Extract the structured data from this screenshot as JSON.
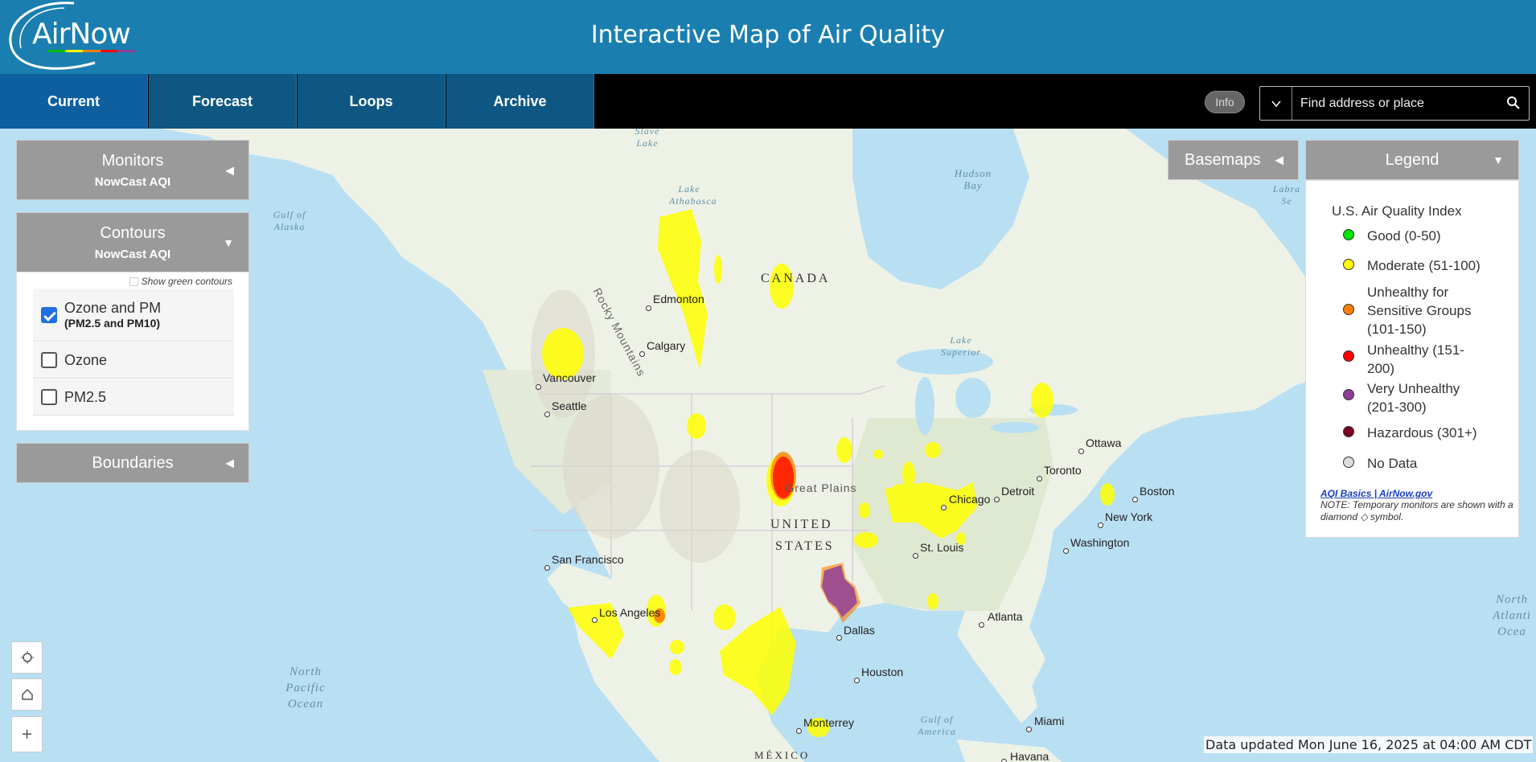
{
  "header": {
    "logo_text": "AirNow",
    "title": "Interactive Map of Air Quality"
  },
  "nav": {
    "tabs": [
      {
        "label": "Current"
      },
      {
        "label": "Forecast"
      },
      {
        "label": "Loops"
      },
      {
        "label": "Archive"
      }
    ],
    "info_label": "Info",
    "search_placeholder": "Find address or place"
  },
  "panels": {
    "monitors": {
      "title": "Monitors",
      "subtitle": "NowCast AQI"
    },
    "contours": {
      "title": "Contours",
      "subtitle": "NowCast AQI",
      "green_toggle": "Show green contours",
      "options": [
        {
          "label": "Ozone and PM",
          "sub": "(PM2.5 and PM10)",
          "checked": true
        },
        {
          "label": "Ozone",
          "sub": "",
          "checked": false
        },
        {
          "label": "PM2.5",
          "sub": "",
          "checked": false
        }
      ]
    },
    "boundaries": {
      "title": "Boundaries"
    },
    "basemaps": {
      "title": "Basemaps"
    }
  },
  "legend": {
    "header": "Legend",
    "title": "U.S. Air Quality Index",
    "items": [
      {
        "label": "Good (0-50)",
        "color": "#00e400"
      },
      {
        "label": "Moderate (51-100)",
        "color": "#ffff00"
      },
      {
        "label": "Unhealthy for Sensitive Groups (101-150)",
        "color": "#ff7e00"
      },
      {
        "label": "Unhealthy (151-200)",
        "color": "#ff0000"
      },
      {
        "label": "Very Unhealthy (201-300)",
        "color": "#8f3f97"
      },
      {
        "label": "Hazardous (301+)",
        "color": "#7e0023"
      },
      {
        "label": "No Data",
        "color": "#dddddd"
      }
    ],
    "link": "AQI Basics | AirNow.gov",
    "note": "NOTE: Temporary monitors are shown with a diamond ◇ symbol."
  },
  "map": {
    "cities": [
      {
        "name": "Edmonton"
      },
      {
        "name": "Calgary"
      },
      {
        "name": "Vancouver"
      },
      {
        "name": "Seattle"
      },
      {
        "name": "San Francisco"
      },
      {
        "name": "Los Angeles"
      },
      {
        "name": "Dallas"
      },
      {
        "name": "Houston"
      },
      {
        "name": "Monterrey"
      },
      {
        "name": "St. Louis"
      },
      {
        "name": "Chicago"
      },
      {
        "name": "Detroit"
      },
      {
        "name": "Toronto"
      },
      {
        "name": "Ottawa"
      },
      {
        "name": "Boston"
      },
      {
        "name": "New York"
      },
      {
        "name": "Washington"
      },
      {
        "name": "Atlanta"
      },
      {
        "name": "Miami"
      },
      {
        "name": "Havana"
      }
    ],
    "labels": {
      "canada": "CANADA",
      "us_line1": "UNITED",
      "us_line2": "STATES",
      "mexico": "MÉXICO",
      "great_plains": "Great Plains",
      "rocky": "Rocky Mountains",
      "slave_lake": "Slave Lake",
      "lake_athabasca": "Lake Athabasca",
      "hudson_bay": "Hudson Bay",
      "gulf_alaska": "Gulf of Alaska",
      "lake_superior": "Lake Superior",
      "labrador": "Labra Se",
      "north_pacific": "North Pacific Ocean",
      "north_atlantic": "North Atlanti Ocea",
      "gulf_america": "Gulf of America"
    },
    "aqi_colors": {
      "moderate": "#ffff00",
      "usg": "#ff7e00",
      "unhealthy": "#ff0000",
      "very_unhealthy": "#8f3f97"
    }
  },
  "status": {
    "updated": "Data updated Mon June 16, 2025 at 04:00 AM CDT"
  }
}
